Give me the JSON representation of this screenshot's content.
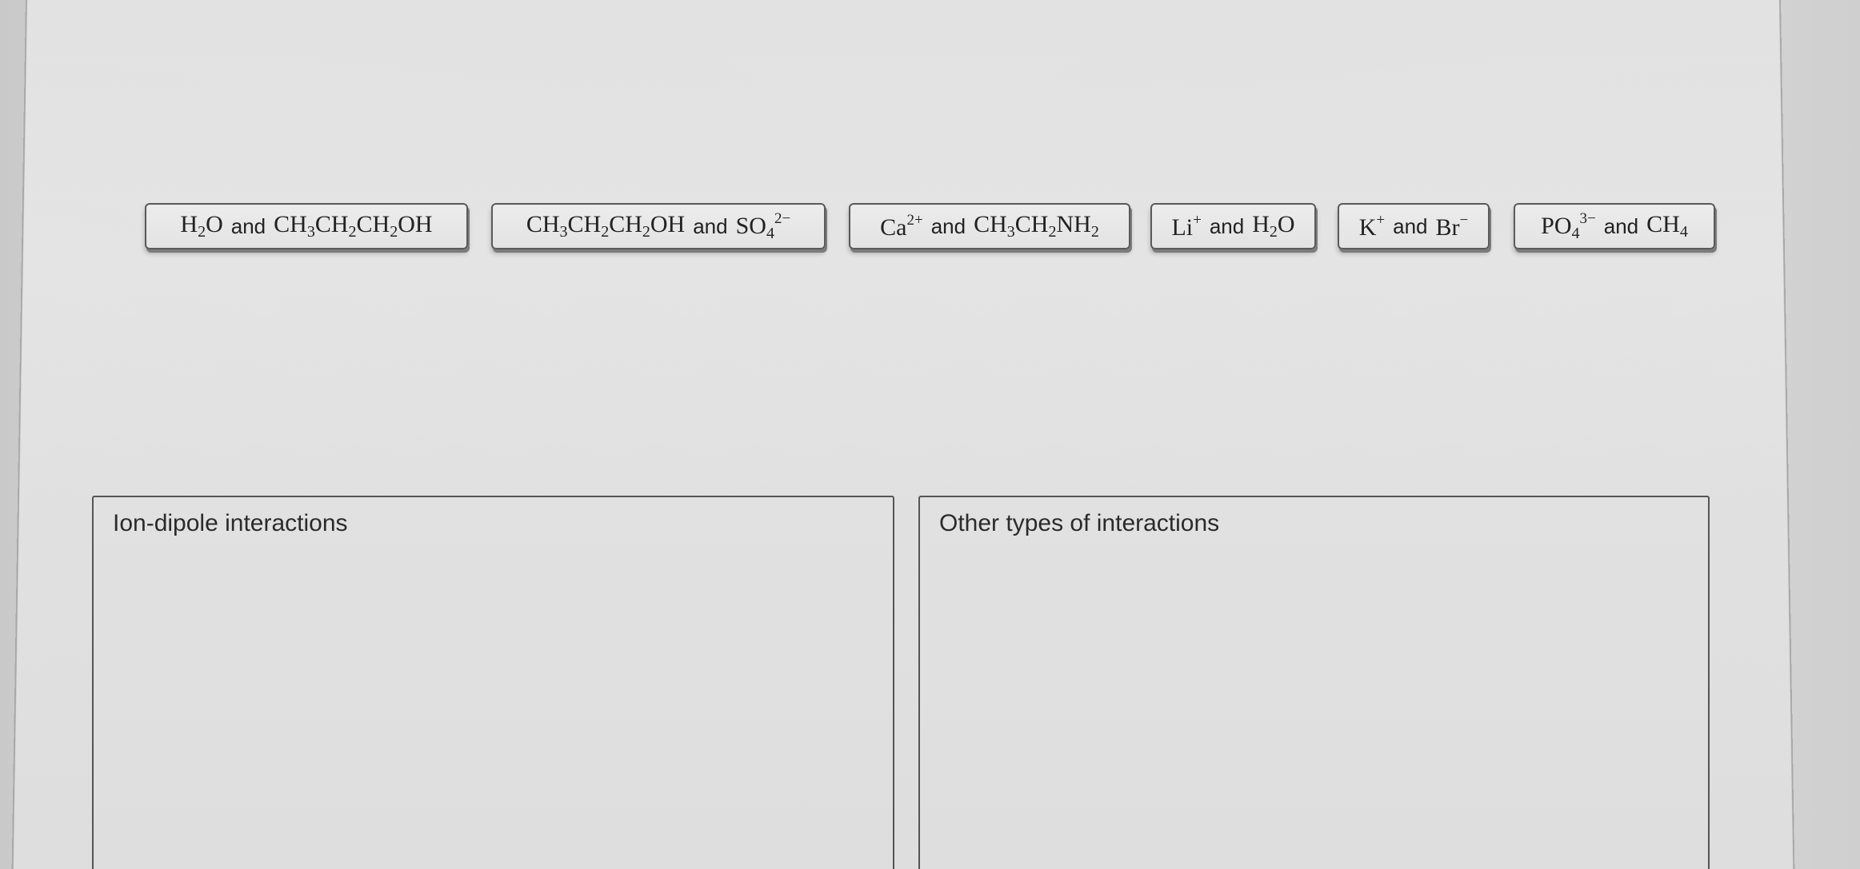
{
  "chips": [
    {
      "id": "chip-1",
      "left": "H",
      "left_sub": "2",
      "left_tail": "O",
      "connector": "and",
      "right_parts": [
        "CH",
        "3",
        "CH",
        "2",
        "CH",
        "2",
        "OH"
      ]
    },
    {
      "id": "chip-2"
    },
    {
      "id": "chip-3"
    },
    {
      "id": "chip-4"
    },
    {
      "id": "chip-5"
    },
    {
      "id": "chip-6"
    }
  ],
  "text": {
    "and": "and",
    "H": "H",
    "O": "O",
    "OH": "OH",
    "CH": "CH",
    "SO": "SO",
    "Ca": "Ca",
    "NH": "NH",
    "Li": "Li",
    "K": "K",
    "Br": "Br",
    "PO": "PO",
    "sub2": "2",
    "sub3": "3",
    "sub4": "4",
    "sup2minus": "2−",
    "sup2plus": "2+",
    "plus": "+",
    "minus": "−",
    "sup3minus": "3−"
  },
  "drop_zones": {
    "ion_dipole": {
      "label": "Ion-dipole interactions"
    },
    "other": {
      "label": "Other types of interactions"
    }
  }
}
